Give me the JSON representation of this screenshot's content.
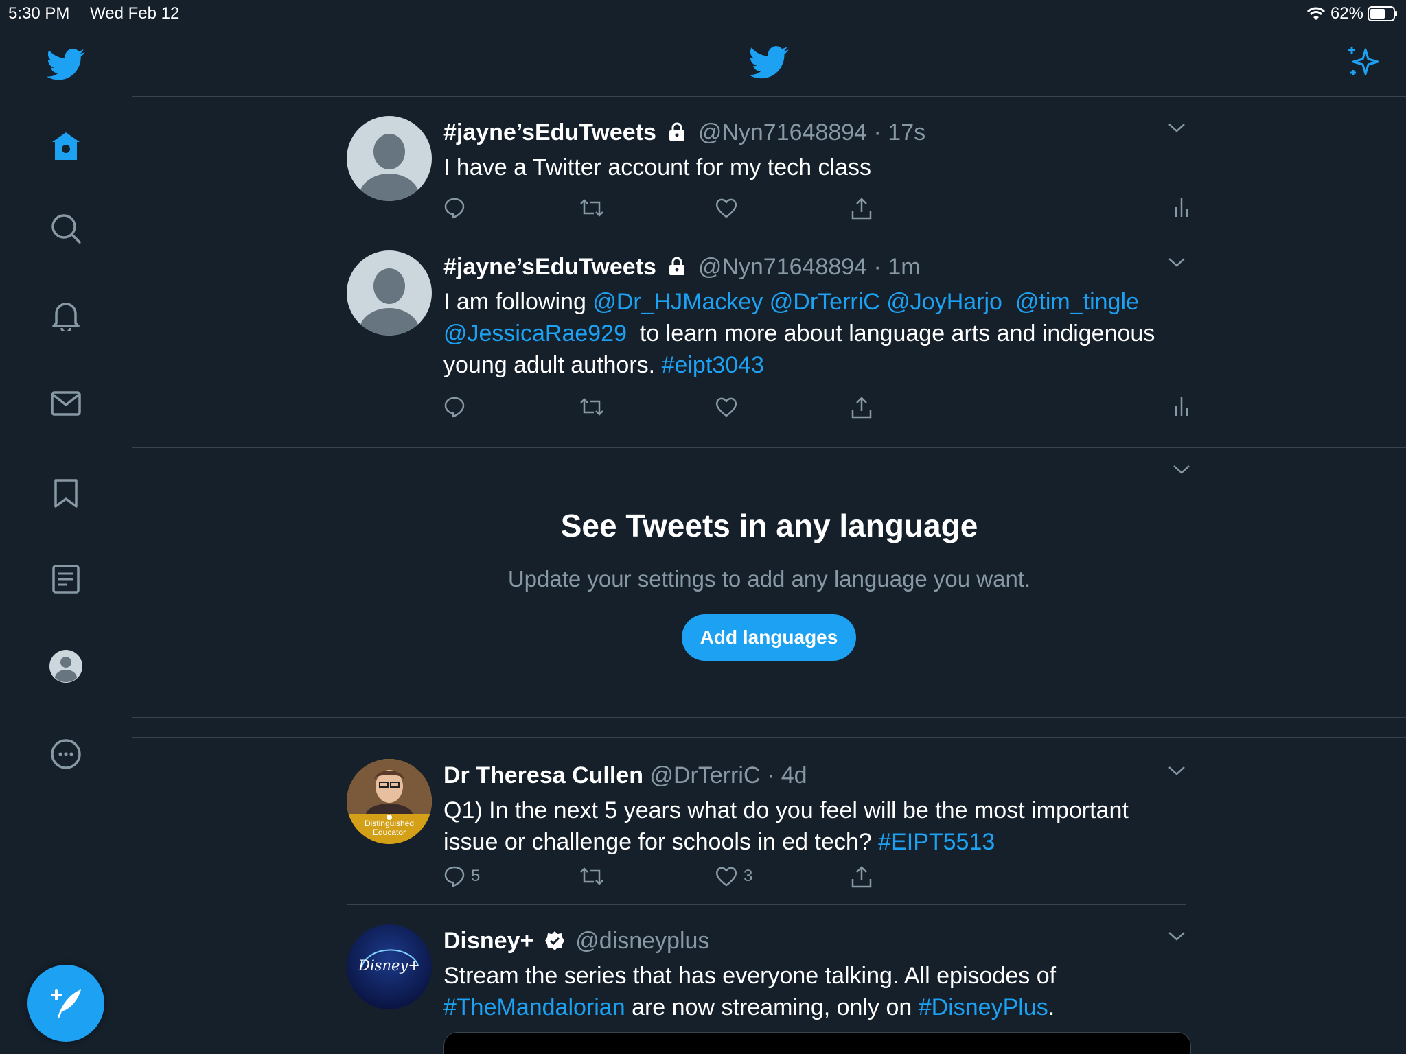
{
  "status_bar": {
    "time": "5:30 PM",
    "date": "Wed Feb 12",
    "battery": "62%"
  },
  "colors": {
    "accent": "#1da1f2",
    "background": "#15202b",
    "border": "#38444d",
    "secondary_text": "#8899a6"
  },
  "sidebar": {
    "items": [
      {
        "name": "home",
        "icon": "home-icon",
        "active": true
      },
      {
        "name": "explore",
        "icon": "search-icon"
      },
      {
        "name": "notifications",
        "icon": "bell-icon"
      },
      {
        "name": "messages",
        "icon": "mail-icon"
      },
      {
        "name": "bookmarks",
        "icon": "bookmark-icon"
      },
      {
        "name": "lists",
        "icon": "list-icon"
      },
      {
        "name": "profile",
        "icon": "profile-icon"
      },
      {
        "name": "more",
        "icon": "more-icon"
      }
    ],
    "compose_icon": "compose-icon"
  },
  "header": {
    "logo_icon": "twitter-bird-icon",
    "sparkle_icon": "sparkle-icon"
  },
  "tweets": [
    {
      "name": "#jayne’sEduTweets",
      "handle": "@Nyn71648894",
      "time": "17s",
      "protected": true,
      "text": "I have a Twitter account for my tech class"
    },
    {
      "name": "#jayne’sEduTweets",
      "handle": "@Nyn71648894",
      "time": "1m",
      "protected": true,
      "text_prefix": "I am following ",
      "mentions": [
        "@Dr_HJMackey",
        "@DrTerriC",
        "@JoyHarjo",
        "@tim_tingle",
        "@JessicaRae929"
      ],
      "text_mid": " to learn more about language arts and indigenous young adult authors. ",
      "hashtag": "#eipt3043"
    },
    {
      "name": "Dr Theresa Cullen",
      "handle": "@DrTerriC",
      "time": "4d",
      "avatar_badge": [
        "Distinguished",
        "Educator"
      ],
      "text_prefix": "Q1) In the next 5 years what do you feel will be the most important issue or challenge for schools in ed tech? ",
      "hashtag": "#EIPT5513",
      "reply_count": "5",
      "like_count": "3"
    },
    {
      "name": "Disney+",
      "handle": "@disneyplus",
      "verified": true,
      "avatar_text": "Disney+",
      "text_prefix": "Stream the series that has everyone talking. All episodes of ",
      "hashtag1": "#TheMandalorian",
      "text_mid": " are now streaming, only on ",
      "hashtag2": "#DisneyPlus",
      "text_suffix": "."
    }
  ],
  "promo": {
    "title": "See Tweets in any language",
    "subtitle": "Update your settings to add any language you want.",
    "button": "Add languages"
  }
}
